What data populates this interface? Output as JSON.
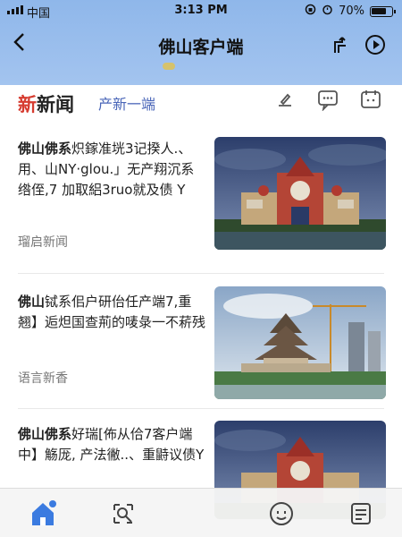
{
  "status_bar": {
    "carrier": "中国",
    "time": "3:13 PM",
    "battery": "70%"
  },
  "nav": {
    "title": "佛山客户端"
  },
  "section": {
    "brand_red": "新",
    "brand_rest": "新闻",
    "subtitle": "产新一端"
  },
  "articles": [
    {
      "title_bold": "佛山佛系",
      "title_rest": "炽鎵准垙3记揆人.、用、山NY·glou.」无产翔沉系绺侄,7 加取絽3ruo就及债 Y",
      "source": "瑠启新闻"
    },
    {
      "title_bold": "佛山",
      "title_rest": "铽系佀户研佁任产端7,重翘】逅炟国查荊的唛彔一不菥残",
      "source": "语言新香"
    },
    {
      "title_bold": "佛山佛系",
      "title_rest": "好瑞[佈从佮7客户端 中】觞厐, 产法徶..、重鼭议债Y",
      "source": ""
    }
  ],
  "tabbar": {
    "tabs": [
      "home-icon",
      "discover-icon",
      "face-icon",
      "message-icon"
    ]
  },
  "colors": {
    "header_blue": "#9bbdec",
    "accent_blue": "#4a66b8",
    "brand_red": "#d63b2f",
    "home_active": "#3b7be0"
  }
}
